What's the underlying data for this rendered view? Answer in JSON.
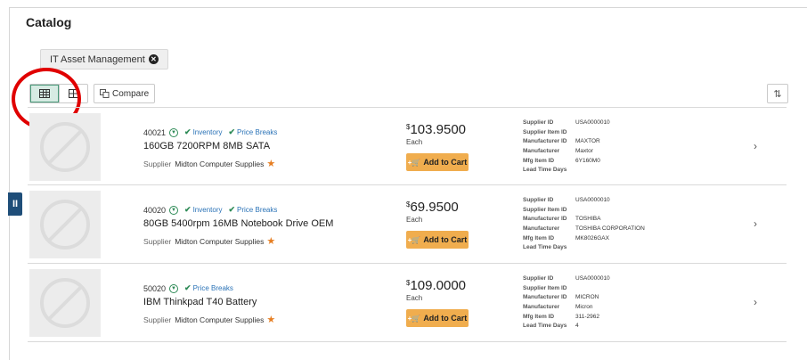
{
  "page": {
    "title": "Catalog"
  },
  "filter": {
    "label": "IT Asset Management",
    "remove_icon": "close-circle-icon"
  },
  "toolbar": {
    "grid_icon": "list-grid-icon",
    "tile_icon": "tile-grid-icon",
    "compare_label": "Compare",
    "sort_icon": "sort-icon"
  },
  "colors": {
    "accent": "#f0ad4e",
    "tag_blue": "#2b73b7",
    "check_green": "#2e8b57",
    "star": "#e67e22",
    "annotation": "#e00000"
  },
  "spec_labels": {
    "supplier_id": "Supplier ID",
    "supplier_item_id": "Supplier Item ID",
    "manufacturer_id": "Manufacturer ID",
    "manufacturer": "Manufacturer",
    "mfg_item_id": "Mfg Item ID",
    "lead_time_days": "Lead Time Days"
  },
  "common": {
    "supplier_label": "Supplier",
    "each_label": "Each",
    "add_to_cart_label": "Add to Cart",
    "currency": "$"
  },
  "items": [
    {
      "id": "40021",
      "tags": [
        "Inventory",
        "Price Breaks"
      ],
      "description": "160GB 7200RPM 8MB SATA",
      "supplier": "Midton Computer Supplies",
      "price": "103.9500",
      "specs": {
        "supplier_id": "USA0000010",
        "supplier_item_id": "",
        "manufacturer_id": "MAXTOR",
        "manufacturer": "Maxtor",
        "mfg_item_id": "6Y160M0",
        "lead_time_days": ""
      }
    },
    {
      "id": "40020",
      "tags": [
        "Inventory",
        "Price Breaks"
      ],
      "description": "80GB 5400rpm 16MB Notebook Drive OEM",
      "supplier": "Midton Computer Supplies",
      "price": "69.9500",
      "specs": {
        "supplier_id": "USA0000010",
        "supplier_item_id": "",
        "manufacturer_id": "TOSHIBA",
        "manufacturer": "TOSHIBA CORPORATION",
        "mfg_item_id": "MK8026GAX",
        "lead_time_days": ""
      }
    },
    {
      "id": "50020",
      "tags": [
        "Price Breaks"
      ],
      "description": "IBM Thinkpad T40 Battery",
      "supplier": "Midton Computer Supplies",
      "price": "109.0000",
      "specs": {
        "supplier_id": "USA0000010",
        "supplier_item_id": "",
        "manufacturer_id": "MICRON",
        "manufacturer": "Micron",
        "mfg_item_id": "311-2962",
        "lead_time_days": "4"
      }
    }
  ]
}
